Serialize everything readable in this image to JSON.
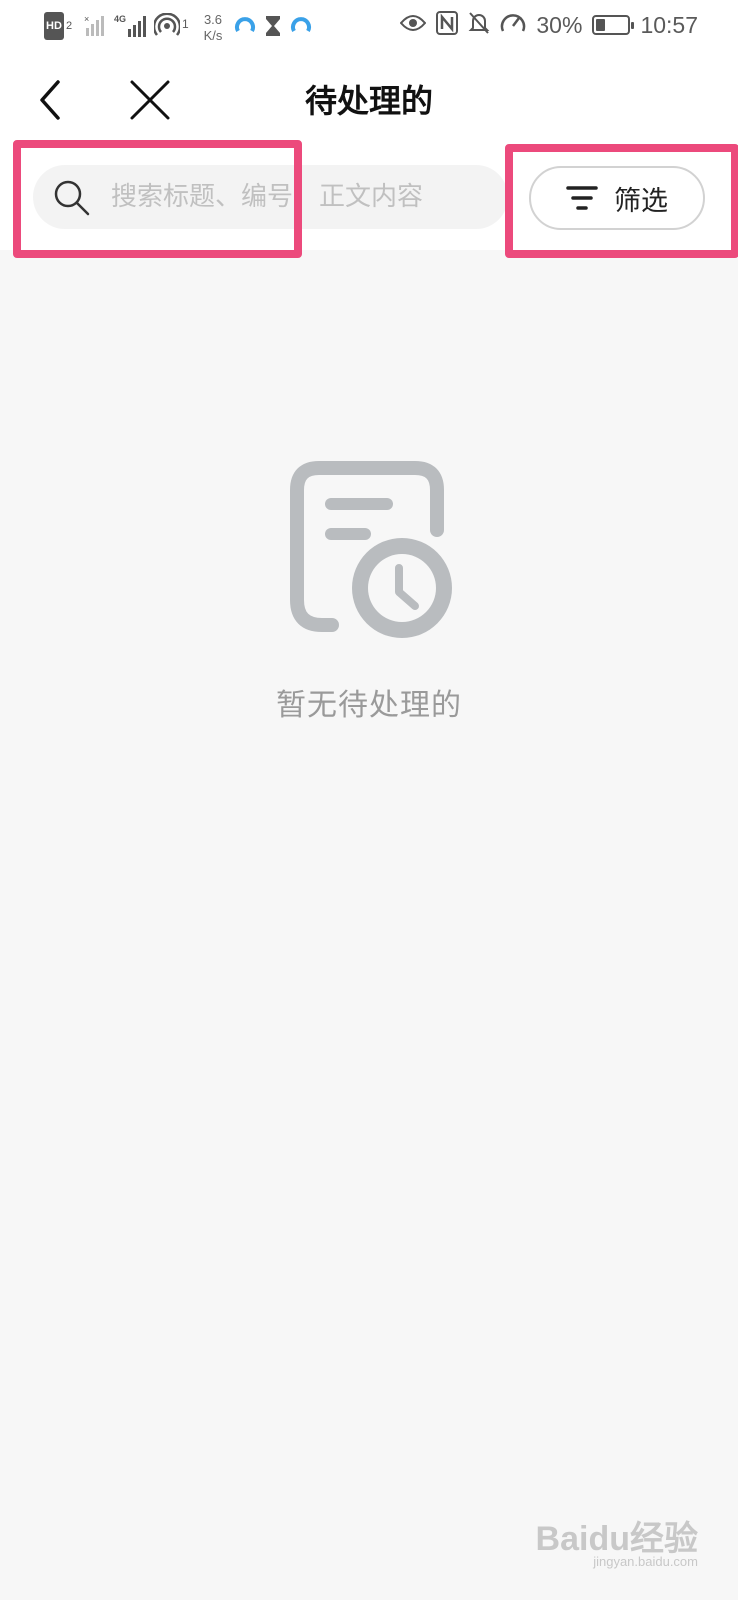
{
  "status_bar": {
    "hd_label": "HD",
    "hd_sub": "2",
    "network": "4G",
    "hotspot_count": "1",
    "speed_value": "3.6",
    "speed_unit": "K/s",
    "battery_percent": "30%",
    "battery_level": 0.3,
    "time": "10:57",
    "icons": [
      "signal-icon",
      "wifi-hotspot-icon",
      "app-icon",
      "hourglass-icon",
      "eye-icon",
      "nfc-icon",
      "mute-icon",
      "speedometer-icon",
      "battery-icon"
    ]
  },
  "header": {
    "title": "待处理的",
    "back_icon": "chevron-left-icon",
    "close_icon": "close-icon"
  },
  "search": {
    "placeholder": "搜索标题、编号、正文内容",
    "value": ""
  },
  "filter": {
    "label": "筛选",
    "icon": "filter-icon"
  },
  "empty_state": {
    "icon": "document-clock-icon",
    "message": "暂无待处理的"
  },
  "watermark": {
    "text": "Baidu经验",
    "sub": "jingyan.baidu.com"
  },
  "colors": {
    "highlight": "#ec4a7c",
    "background": "#f7f7f7",
    "empty_icon": "#b9bcbf"
  }
}
